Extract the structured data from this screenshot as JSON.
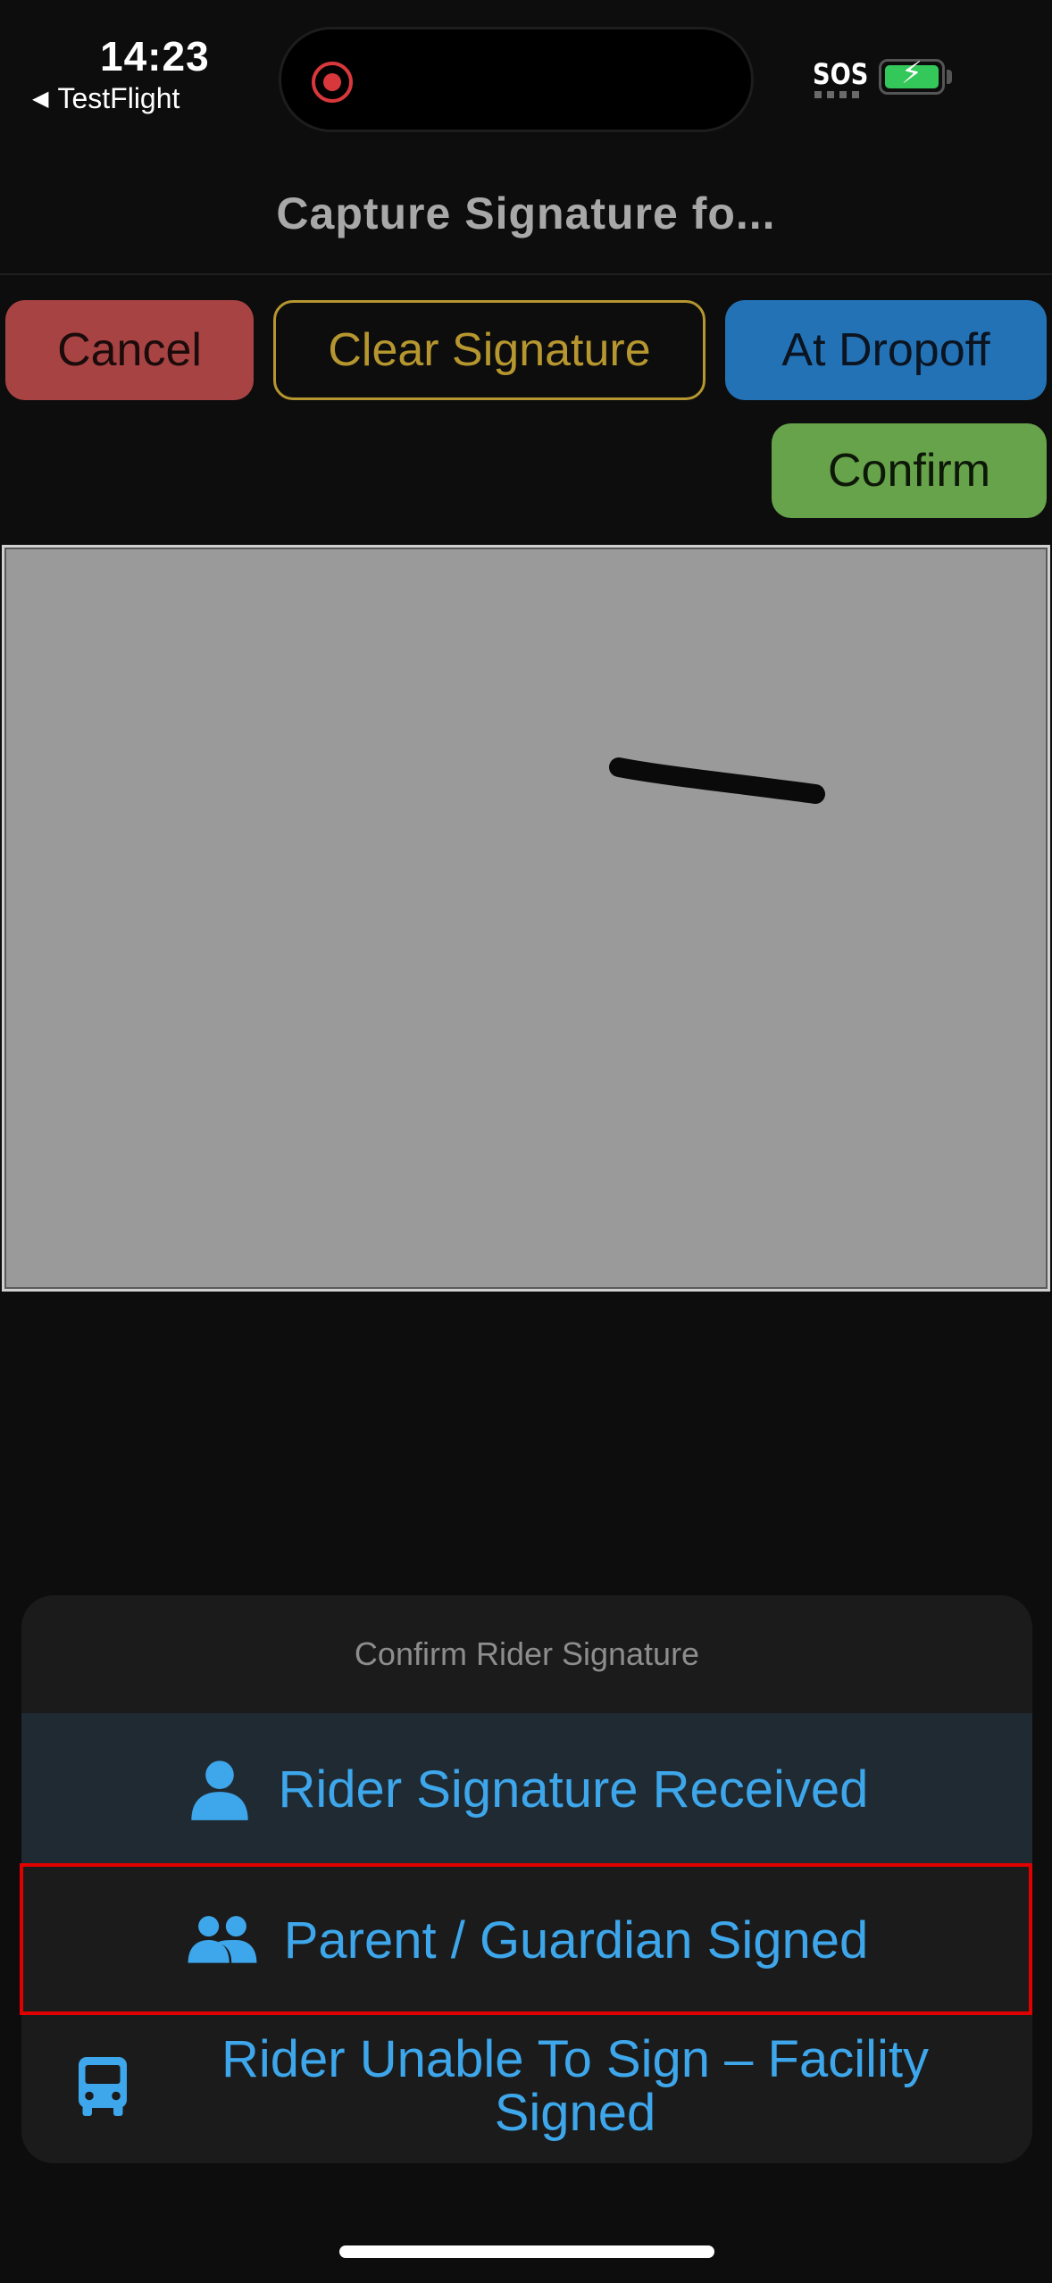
{
  "status_bar": {
    "time": "14:23",
    "back_app": "TestFlight",
    "carrier_text": "SOS"
  },
  "header": {
    "title": "Capture Signature fo..."
  },
  "toolbar": {
    "cancel_label": "Cancel",
    "clear_label": "Clear Signature",
    "dropoff_label": "At Dropoff",
    "confirm_label": "Confirm"
  },
  "colors": {
    "cancel": "#a84343",
    "clear_outline": "#b6962f",
    "dropoff": "#2372b6",
    "confirm": "#67a34a",
    "accent_blue": "#3ea6ea",
    "highlight": "#e00000"
  },
  "action_sheet": {
    "title": "Confirm Rider Signature",
    "options": [
      {
        "label": "Rider Signature Received",
        "icon": "person-icon"
      },
      {
        "label": "Parent / Guardian Signed",
        "icon": "people-icon"
      },
      {
        "label": "Rider Unable To Sign – Facility Signed",
        "icon": "bus-icon"
      }
    ]
  }
}
